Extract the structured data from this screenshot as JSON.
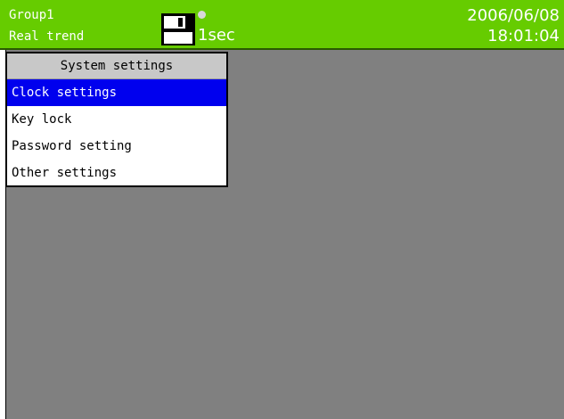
{
  "status_bar": {
    "group_name": "Group1",
    "display_mode": "Real trend",
    "storage_icon": "floppy-disk-icon",
    "recording_indicator": "status-dot-icon",
    "sampling_interval": "1sec",
    "date": "2006/06/08",
    "time": "18:01:04",
    "colors": {
      "background": "#66cc00",
      "text": "#ffffff"
    }
  },
  "menu": {
    "title": "System settings",
    "items": [
      {
        "label": "Clock settings",
        "selected": true
      },
      {
        "label": "Key lock",
        "selected": false
      },
      {
        "label": "Password setting",
        "selected": false
      },
      {
        "label": "Other settings",
        "selected": false
      }
    ],
    "colors": {
      "selected_background": "#0000ee",
      "title_background": "#c8c8c8"
    }
  },
  "content_area": {
    "background": "#808080"
  }
}
